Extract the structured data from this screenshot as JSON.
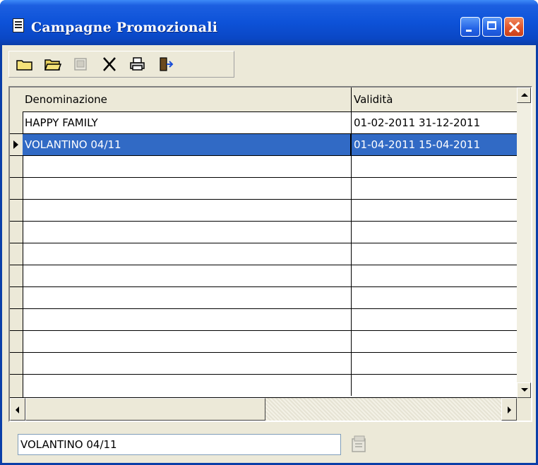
{
  "window": {
    "title": "Campagne Promozionali",
    "controls": [
      "minimize",
      "maximize",
      "close"
    ]
  },
  "toolbar": {
    "buttons": [
      {
        "icon": "folder-new-icon"
      },
      {
        "icon": "folder-open-icon"
      },
      {
        "icon": "view-icon",
        "disabled": true
      },
      {
        "icon": "delete-x-icon"
      },
      {
        "icon": "printer-icon"
      },
      {
        "icon": "exit-door-icon"
      }
    ]
  },
  "grid": {
    "columns": [
      "Denominazione",
      "Validità"
    ],
    "rows": [
      {
        "name": "HAPPY FAMILY",
        "validity": "01-02-2011  31-12-2011"
      },
      {
        "name": "VOLANTINO 04/11",
        "validity": "01-04-2011  15-04-2011"
      },
      {
        "name": "",
        "validity": ""
      },
      {
        "name": "",
        "validity": ""
      },
      {
        "name": "",
        "validity": ""
      },
      {
        "name": "",
        "validity": ""
      },
      {
        "name": "",
        "validity": ""
      },
      {
        "name": "",
        "validity": ""
      },
      {
        "name": "",
        "validity": ""
      },
      {
        "name": "",
        "validity": ""
      },
      {
        "name": "",
        "validity": ""
      },
      {
        "name": "",
        "validity": ""
      },
      {
        "name": "",
        "validity": ""
      }
    ],
    "selected_row": 1
  },
  "footer": {
    "current_value": "VOLANTINO 04/11"
  },
  "colors": {
    "titlebar": "#0a47c5",
    "selection": "#316ac5",
    "face": "#ece9d8"
  }
}
